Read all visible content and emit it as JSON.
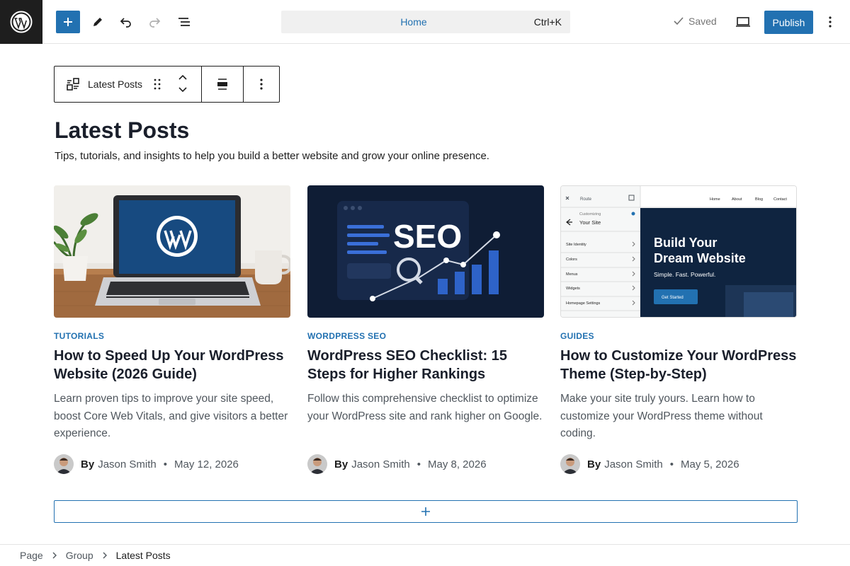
{
  "topbar": {
    "command_title": "Home",
    "command_shortcut": "Ctrl+K",
    "saved_label": "Saved",
    "publish_label": "Publish"
  },
  "block_toolbar": {
    "block_label": "Latest Posts"
  },
  "main": {
    "heading": "Latest Posts",
    "subtitle": "Tips, tutorials, and insights to help you build a better website and grow your online presence."
  },
  "posts": [
    {
      "category": "TUTORIALS",
      "title": "How to Speed Up Your WordPress Website (2026 Guide)",
      "excerpt": "Learn proven tips to improve your site speed, boost Core Web Vitals, and give visitors a better experience.",
      "by_label": "By",
      "author": "Jason Smith",
      "date": "May 12, 2026"
    },
    {
      "category": "WORDPRESS SEO",
      "title": "WordPress SEO Checklist: 15 Steps for Higher Rankings",
      "excerpt": "Follow this comprehensive checklist to optimize your WordPress site and rank higher on Google.",
      "by_label": "By",
      "author": "Jason Smith",
      "date": "May 8, 2026",
      "image_text": "SEO"
    },
    {
      "category": "GUIDES",
      "title": "How to Customize Your WordPress Theme (Step-by-Step)",
      "excerpt": "Make your site truly yours. Learn how to customize your WordPress theme without coding.",
      "by_label": "By",
      "author": "Jason Smith",
      "date": "May 5, 2026",
      "image": {
        "panel_small": "Customizing",
        "panel_title": "Your Site",
        "menu": [
          "Site Identity",
          "Colors",
          "Menus",
          "Widgets",
          "Homepage Settings"
        ],
        "nav": [
          "Home",
          "About",
          "Blog",
          "Contact"
        ],
        "hero_title_line1": "Build Your",
        "hero_title_line2": "Dream Website",
        "hero_tagline": "Simple. Fast. Powerful.",
        "hero_button": "Get Started",
        "top_label": "Route"
      }
    }
  ],
  "footer": {
    "breadcrumbs": [
      "Page",
      "Group",
      "Latest Posts"
    ]
  },
  "colors": {
    "accent": "#2271b1",
    "dark": "#1e1e1e",
    "seo_bg": "#0f1d35"
  }
}
